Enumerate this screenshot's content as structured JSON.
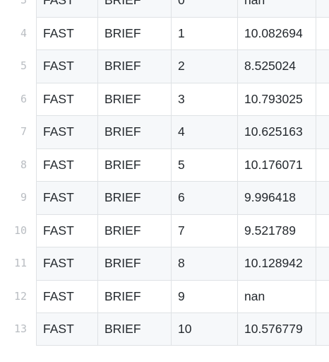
{
  "rows": [
    {
      "line": "3",
      "cells": [
        "FAST",
        "BRIEF",
        "0",
        "nan"
      ]
    },
    {
      "line": "4",
      "cells": [
        "FAST",
        "BRIEF",
        "1",
        "10.082694"
      ]
    },
    {
      "line": "5",
      "cells": [
        "FAST",
        "BRIEF",
        "2",
        "8.525024"
      ]
    },
    {
      "line": "6",
      "cells": [
        "FAST",
        "BRIEF",
        "3",
        "10.793025"
      ]
    },
    {
      "line": "7",
      "cells": [
        "FAST",
        "BRIEF",
        "4",
        "10.625163"
      ]
    },
    {
      "line": "8",
      "cells": [
        "FAST",
        "BRIEF",
        "5",
        "10.176071"
      ]
    },
    {
      "line": "9",
      "cells": [
        "FAST",
        "BRIEF",
        "6",
        "9.996418"
      ]
    },
    {
      "line": "10",
      "cells": [
        "FAST",
        "BRIEF",
        "7",
        "9.521789"
      ]
    },
    {
      "line": "11",
      "cells": [
        "FAST",
        "BRIEF",
        "8",
        "10.128942"
      ]
    },
    {
      "line": "12",
      "cells": [
        "FAST",
        "BRIEF",
        "9",
        "nan"
      ]
    },
    {
      "line": "13",
      "cells": [
        "FAST",
        "BRIEF",
        "10",
        "10.576779"
      ]
    }
  ],
  "colors": {
    "border": "#dfe2e5",
    "stripe": "#f6f8fa",
    "text": "#24292e",
    "line_number": "#b9bdc2"
  }
}
